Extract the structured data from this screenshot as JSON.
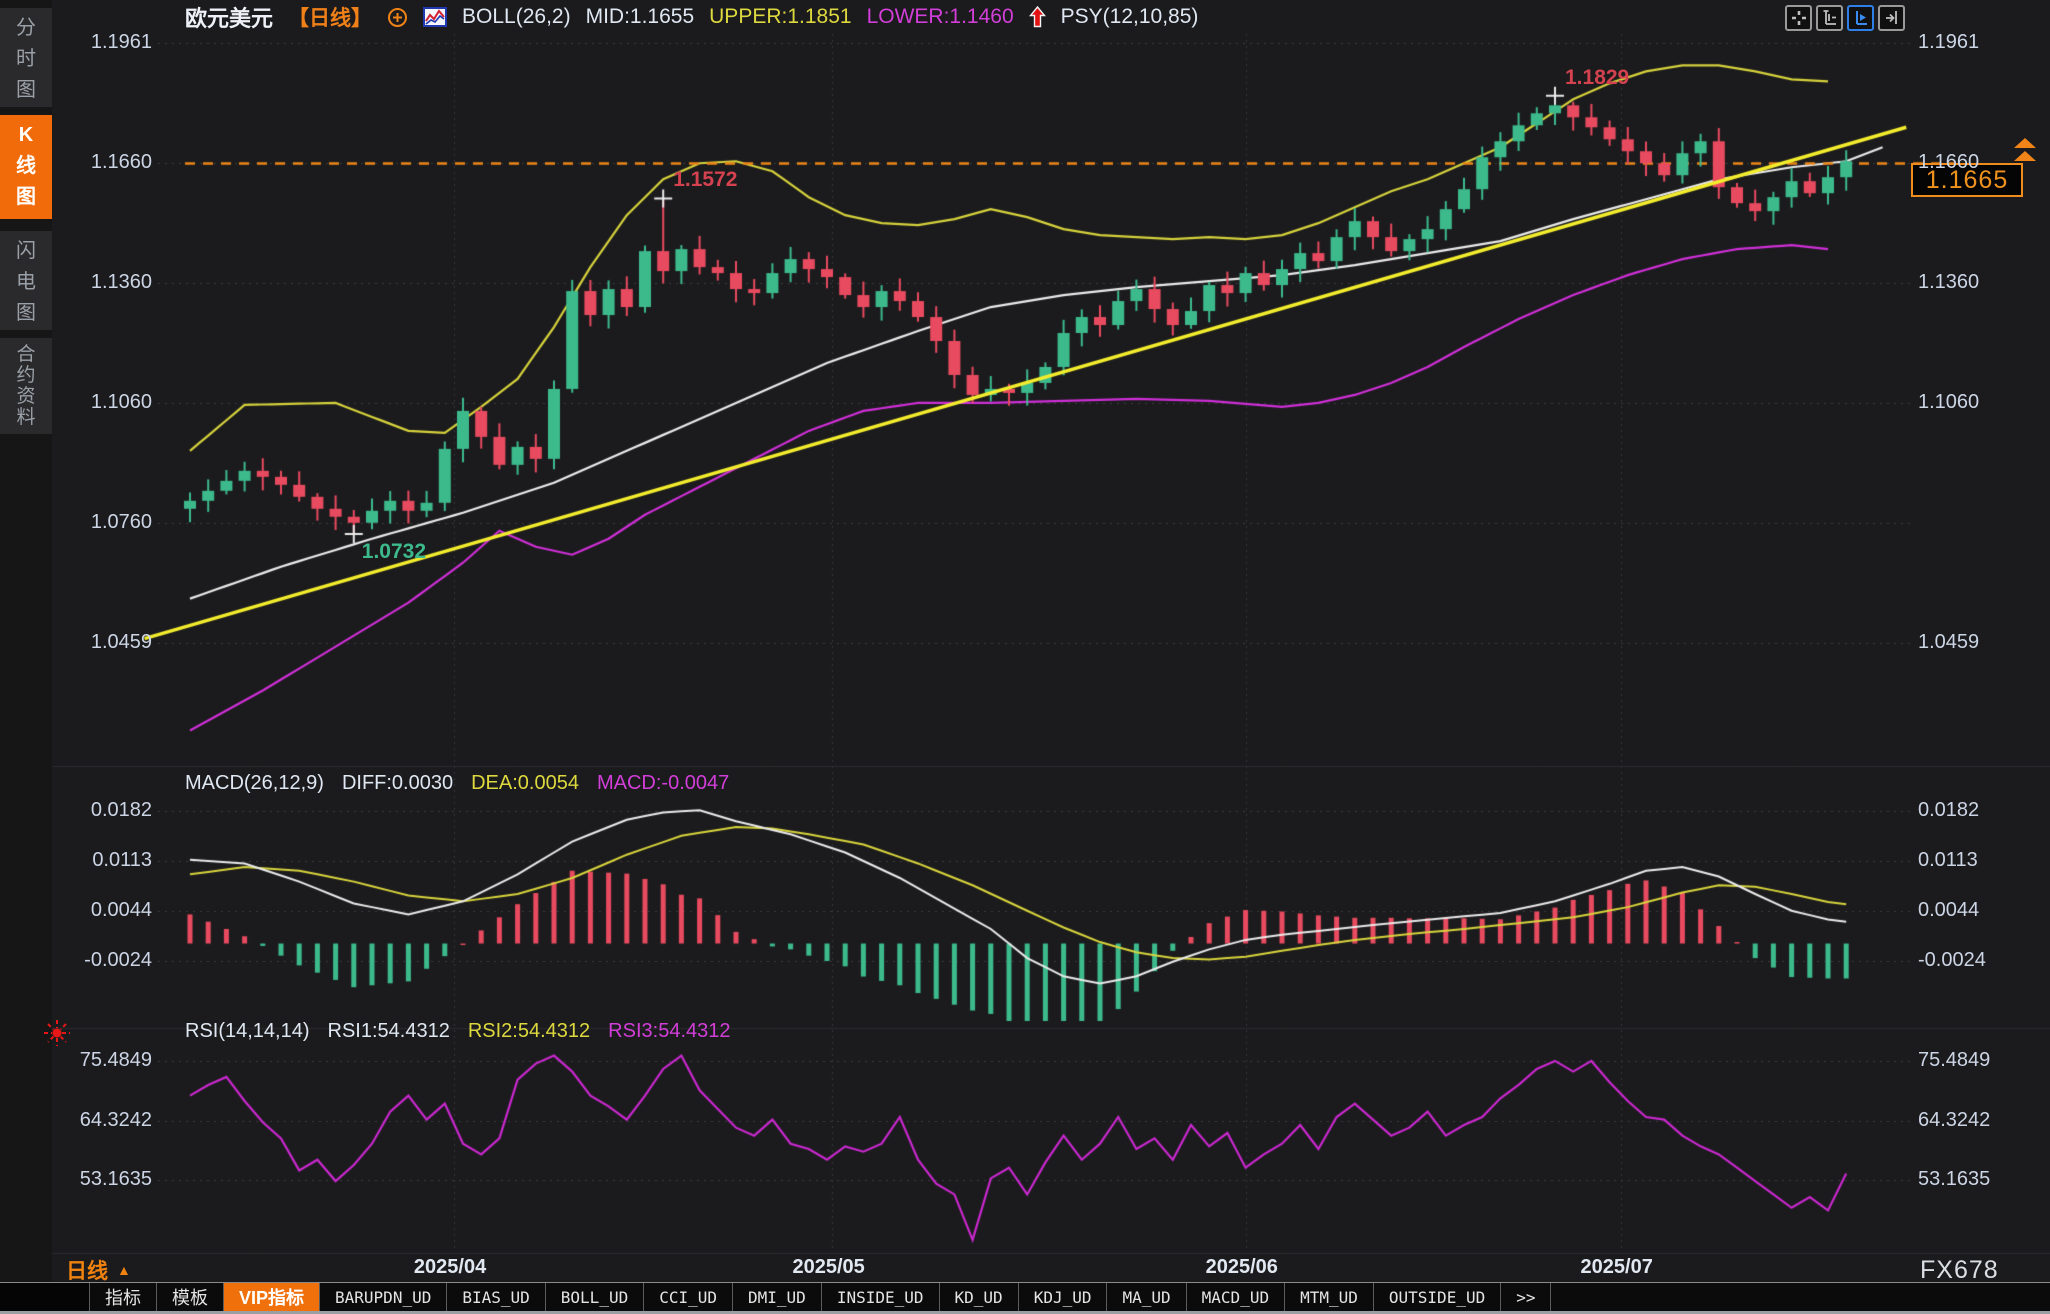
{
  "app": {
    "brand": "FX678"
  },
  "sidebar": {
    "items": [
      {
        "label": "分时图",
        "active": false
      },
      {
        "label": "K线图",
        "active": true
      },
      {
        "label": "闪电图",
        "active": false
      },
      {
        "label": "合约资料",
        "active": false
      }
    ]
  },
  "header": {
    "symbol": "欧元美元",
    "period_tag": "【日线】",
    "boll_label": "BOLL(26,2)",
    "mid": "MID:1.1655",
    "upper": "UPPER:1.1851",
    "lower": "LOWER:1.1460",
    "psy": "PSY(12,10,85)",
    "icons": [
      "compare-circle-plus-icon",
      "mini-chart-icon",
      "red-up-arrow-icon"
    ]
  },
  "toolbar": {
    "buttons": [
      {
        "name": "pan-icon",
        "active": false
      },
      {
        "name": "y-axis-range-icon",
        "active": false
      },
      {
        "name": "auto-follow-icon",
        "active": true
      },
      {
        "name": "x-axis-shift-icon",
        "active": false
      }
    ]
  },
  "price_pane": {
    "last_price": "1.1665",
    "axis_left": [
      "1.1961",
      "1.1660",
      "1.1360",
      "1.1060",
      "1.0760",
      "1.0459"
    ],
    "axis_right": [
      "1.1961",
      "1.1660",
      "1.1360",
      "1.1060",
      "1.0459"
    ]
  },
  "macd_pane": {
    "title": "MACD(26,12,9)",
    "diff_label": "DIFF:0.0030",
    "dea_label": "DEA:0.0054",
    "macd_label": "MACD:-0.0047",
    "axis": [
      "0.0182",
      "0.0113",
      "0.0044",
      "-0.0024"
    ]
  },
  "rsi_pane": {
    "title": "RSI(14,14,14)",
    "rsi1_label": "RSI1:54.4312",
    "rsi2_label": "RSI2:54.4312",
    "rsi3_label": "RSI3:54.4312",
    "axis": [
      "75.4849",
      "64.3242",
      "53.1635"
    ]
  },
  "xaxis": {
    "period_label": "日线"
  },
  "tabs": [
    {
      "label": "指标",
      "active": false,
      "mono": false
    },
    {
      "label": "模板",
      "active": false,
      "mono": false
    },
    {
      "label": "VIP指标",
      "active": true,
      "mono": false
    },
    {
      "label": "BARUPDN_UD",
      "active": false,
      "mono": true
    },
    {
      "label": "BIAS_UD",
      "active": false,
      "mono": true
    },
    {
      "label": "BOLL_UD",
      "active": false,
      "mono": true
    },
    {
      "label": "CCI_UD",
      "active": false,
      "mono": true
    },
    {
      "label": "DMI_UD",
      "active": false,
      "mono": true
    },
    {
      "label": "INSIDE_UD",
      "active": false,
      "mono": true
    },
    {
      "label": "KD_UD",
      "active": false,
      "mono": true
    },
    {
      "label": "KDJ_UD",
      "active": false,
      "mono": true
    },
    {
      "label": "MA_UD",
      "active": false,
      "mono": true
    },
    {
      "label": "MACD_UD",
      "active": false,
      "mono": true
    },
    {
      "label": "MTM_UD",
      "active": false,
      "mono": true
    },
    {
      "label": "OUTSIDE_UD",
      "active": false,
      "mono": true
    },
    {
      "label": ">>",
      "active": false,
      "mono": true
    }
  ],
  "colors": {
    "accent_orange": "#f0700c",
    "candle_up": "#3cba8c",
    "candle_down": "#e84a5f",
    "boll_upper": "#d6d23c",
    "boll_mid": "#ebebeb",
    "boll_lower": "#d02fd8",
    "trend_line": "#f3ed2d",
    "level_line": "#ee8617",
    "macd_diff": "#ebebeb",
    "macd_dea": "#d8d43c",
    "rsi_line": "#ca28cf",
    "annotation_high": "#d4414f",
    "annotation_low": "#3cba8c"
  },
  "chart_data": {
    "type": "candlestick",
    "title": "欧元美元 日线 (EUR/USD daily with BOLL, MACD, RSI)",
    "x_months": [
      {
        "label": "2025/04",
        "index": 14.5
      },
      {
        "label": "2025/05",
        "index": 35.3
      },
      {
        "label": "2025/06",
        "index": 58.0
      },
      {
        "label": "2025/07",
        "index": 78.6
      }
    ],
    "first_open": 1.0795,
    "closes": [
      1.0815,
      1.084,
      1.0865,
      1.089,
      1.0875,
      1.0855,
      1.0825,
      1.0795,
      1.0775,
      1.076,
      1.079,
      1.0815,
      1.079,
      1.081,
      1.0945,
      1.104,
      1.0975,
      1.0905,
      1.095,
      1.092,
      1.1095,
      1.134,
      1.128,
      1.1345,
      1.13,
      1.144,
      1.139,
      1.1445,
      1.14,
      1.1385,
      1.1345,
      1.1335,
      1.1385,
      1.142,
      1.1395,
      1.1375,
      1.133,
      1.13,
      1.134,
      1.1315,
      1.1275,
      1.1215,
      1.113,
      1.108,
      1.1095,
      1.1085,
      1.111,
      1.115,
      1.1235,
      1.1275,
      1.1255,
      1.1315,
      1.1345,
      1.1295,
      1.1255,
      1.129,
      1.1355,
      1.1335,
      1.1385,
      1.1355,
      1.1395,
      1.1435,
      1.1415,
      1.1475,
      1.1515,
      1.1475,
      1.144,
      1.147,
      1.1495,
      1.1545,
      1.1595,
      1.1675,
      1.1715,
      1.1755,
      1.1785,
      1.1805,
      1.1775,
      1.175,
      1.172,
      1.169,
      1.166,
      1.163,
      1.1685,
      1.1715,
      1.16,
      1.156,
      1.154,
      1.1575,
      1.1615,
      1.1585,
      1.1625,
      1.1665
    ],
    "extremes": [
      {
        "index": 9,
        "kind": "low",
        "price": 1.0732,
        "label": "1.0732"
      },
      {
        "index": 26,
        "kind": "high",
        "price": 1.1572,
        "label": "1.1572"
      },
      {
        "index": 75,
        "kind": "high",
        "price": 1.1829,
        "label": "1.1829"
      }
    ],
    "last_price": 1.1665,
    "level_line_price": 1.166,
    "boll_mid": [
      [
        0,
        1.057
      ],
      [
        5,
        1.065
      ],
      [
        10,
        1.072
      ],
      [
        15,
        1.0785
      ],
      [
        20,
        1.086
      ],
      [
        25,
        1.096
      ],
      [
        30,
        1.106
      ],
      [
        35,
        1.116
      ],
      [
        40,
        1.124
      ],
      [
        44,
        1.13
      ],
      [
        48,
        1.133
      ],
      [
        52,
        1.135
      ],
      [
        56,
        1.1365
      ],
      [
        60,
        1.138
      ],
      [
        64,
        1.1405
      ],
      [
        68,
        1.1435
      ],
      [
        72,
        1.1465
      ],
      [
        76,
        1.152
      ],
      [
        80,
        1.157
      ],
      [
        84,
        1.162
      ],
      [
        88,
        1.165
      ],
      [
        91,
        1.1665
      ],
      [
        93,
        1.17
      ]
    ],
    "boll_upper": [
      [
        0,
        1.094
      ],
      [
        3,
        1.1055
      ],
      [
        8,
        1.106
      ],
      [
        12,
        1.099
      ],
      [
        14,
        1.0985
      ],
      [
        16,
        1.105
      ],
      [
        18,
        1.112
      ],
      [
        20,
        1.125
      ],
      [
        22,
        1.14
      ],
      [
        24,
        1.153
      ],
      [
        26,
        1.162
      ],
      [
        28,
        1.166
      ],
      [
        30,
        1.1665
      ],
      [
        32,
        1.164
      ],
      [
        34,
        1.1575
      ],
      [
        36,
        1.153
      ],
      [
        38,
        1.151
      ],
      [
        40,
        1.1505
      ],
      [
        42,
        1.152
      ],
      [
        44,
        1.1545
      ],
      [
        46,
        1.1525
      ],
      [
        48,
        1.1495
      ],
      [
        50,
        1.148
      ],
      [
        52,
        1.1475
      ],
      [
        54,
        1.147
      ],
      [
        56,
        1.1475
      ],
      [
        58,
        1.147
      ],
      [
        60,
        1.148
      ],
      [
        62,
        1.151
      ],
      [
        64,
        1.155
      ],
      [
        66,
        1.159
      ],
      [
        68,
        1.162
      ],
      [
        70,
        1.166
      ],
      [
        72,
        1.17
      ],
      [
        74,
        1.176
      ],
      [
        76,
        1.182
      ],
      [
        78,
        1.186
      ],
      [
        80,
        1.189
      ],
      [
        82,
        1.1905
      ],
      [
        84,
        1.1905
      ],
      [
        86,
        1.189
      ],
      [
        88,
        1.187
      ],
      [
        90,
        1.1865
      ]
    ],
    "boll_lower": [
      [
        0,
        1.024
      ],
      [
        4,
        1.034
      ],
      [
        8,
        1.045
      ],
      [
        12,
        1.056
      ],
      [
        15,
        1.066
      ],
      [
        17,
        1.074
      ],
      [
        19,
        1.07
      ],
      [
        21,
        1.068
      ],
      [
        23,
        1.072
      ],
      [
        25,
        1.078
      ],
      [
        28,
        1.085
      ],
      [
        31,
        1.092
      ],
      [
        34,
        1.099
      ],
      [
        37,
        1.104
      ],
      [
        40,
        1.106
      ],
      [
        44,
        1.106
      ],
      [
        48,
        1.1065
      ],
      [
        52,
        1.107
      ],
      [
        56,
        1.1065
      ],
      [
        60,
        1.105
      ],
      [
        62,
        1.106
      ],
      [
        64,
        1.108
      ],
      [
        66,
        1.111
      ],
      [
        68,
        1.115
      ],
      [
        70,
        1.12
      ],
      [
        73,
        1.127
      ],
      [
        76,
        1.133
      ],
      [
        79,
        1.138
      ],
      [
        82,
        1.142
      ],
      [
        85,
        1.1445
      ],
      [
        88,
        1.1455
      ],
      [
        90,
        1.1445
      ]
    ],
    "trend_line": [
      [
        -2.5,
        1.047
      ],
      [
        94.3,
        1.175
      ]
    ],
    "macd": {
      "diff_anchors": [
        [
          0,
          0.0115
        ],
        [
          3,
          0.011
        ],
        [
          6,
          0.0085
        ],
        [
          9,
          0.0055
        ],
        [
          12,
          0.004
        ],
        [
          15,
          0.0058
        ],
        [
          18,
          0.0095
        ],
        [
          21,
          0.014
        ],
        [
          24,
          0.017
        ],
        [
          26,
          0.018
        ],
        [
          28,
          0.0183
        ],
        [
          30,
          0.0168
        ],
        [
          33,
          0.015
        ],
        [
          36,
          0.0125
        ],
        [
          39,
          0.009
        ],
        [
          42,
          0.0048
        ],
        [
          44,
          0.002
        ],
        [
          46,
          -0.002
        ],
        [
          48,
          -0.0045
        ],
        [
          50,
          -0.0055
        ],
        [
          52,
          -0.0045
        ],
        [
          54,
          -0.0025
        ],
        [
          56,
          -0.0008
        ],
        [
          58,
          0.0005
        ],
        [
          60,
          0.0012
        ],
        [
          63,
          0.002
        ],
        [
          66,
          0.0028
        ],
        [
          69,
          0.0035
        ],
        [
          72,
          0.0042
        ],
        [
          75,
          0.0058
        ],
        [
          78,
          0.0082
        ],
        [
          80,
          0.01
        ],
        [
          82,
          0.0105
        ],
        [
          84,
          0.0092
        ],
        [
          86,
          0.0068
        ],
        [
          88,
          0.0045
        ],
        [
          90,
          0.0033
        ],
        [
          91,
          0.003
        ]
      ],
      "dea_anchors": [
        [
          0,
          0.0095
        ],
        [
          3,
          0.0105
        ],
        [
          6,
          0.01
        ],
        [
          9,
          0.0085
        ],
        [
          12,
          0.0066
        ],
        [
          15,
          0.0058
        ],
        [
          18,
          0.0068
        ],
        [
          21,
          0.009
        ],
        [
          24,
          0.0122
        ],
        [
          27,
          0.0148
        ],
        [
          30,
          0.016
        ],
        [
          32,
          0.0158
        ],
        [
          34,
          0.015
        ],
        [
          37,
          0.0136
        ],
        [
          40,
          0.011
        ],
        [
          43,
          0.008
        ],
        [
          46,
          0.0045
        ],
        [
          48,
          0.0022
        ],
        [
          50,
          0.0002
        ],
        [
          52,
          -0.0012
        ],
        [
          54,
          -0.002
        ],
        [
          56,
          -0.0022
        ],
        [
          58,
          -0.0018
        ],
        [
          60,
          -0.001
        ],
        [
          62,
          -0.0002
        ],
        [
          64,
          0.0005
        ],
        [
          67,
          0.0013
        ],
        [
          70,
          0.002
        ],
        [
          73,
          0.0028
        ],
        [
          76,
          0.0036
        ],
        [
          79,
          0.005
        ],
        [
          82,
          0.007
        ],
        [
          84,
          0.008
        ],
        [
          86,
          0.0078
        ],
        [
          88,
          0.0068
        ],
        [
          90,
          0.0057
        ],
        [
          91,
          0.0054
        ]
      ],
      "histogram_rule": "2*(DIFF-DEA)"
    },
    "rsi_values": [
      69,
      71,
      72.5,
      68,
      64,
      61,
      55,
      57,
      53,
      56,
      60,
      66,
      69,
      64.5,
      67.5,
      60,
      58,
      61,
      72,
      75,
      76.5,
      73.5,
      69,
      67,
      64.5,
      69,
      74,
      76.5,
      70,
      66.5,
      63,
      61.5,
      64.5,
      60,
      59,
      57,
      59.5,
      58.5,
      60,
      65,
      57,
      52.5,
      50.5,
      42,
      53.5,
      55.5,
      50.5,
      56.5,
      61.5,
      57,
      60,
      65,
      59,
      61,
      57,
      63.5,
      59.5,
      62,
      55.5,
      58,
      60,
      63.5,
      59,
      65,
      67.5,
      64.5,
      61.5,
      63,
      66,
      61.5,
      63.5,
      65,
      68.5,
      71,
      74,
      75.5,
      73.5,
      75.5,
      71.5,
      68,
      65,
      64.5,
      61.5,
      59.5,
      58,
      55.5,
      53,
      50.5,
      48,
      50,
      47.5,
      54.43
    ]
  }
}
